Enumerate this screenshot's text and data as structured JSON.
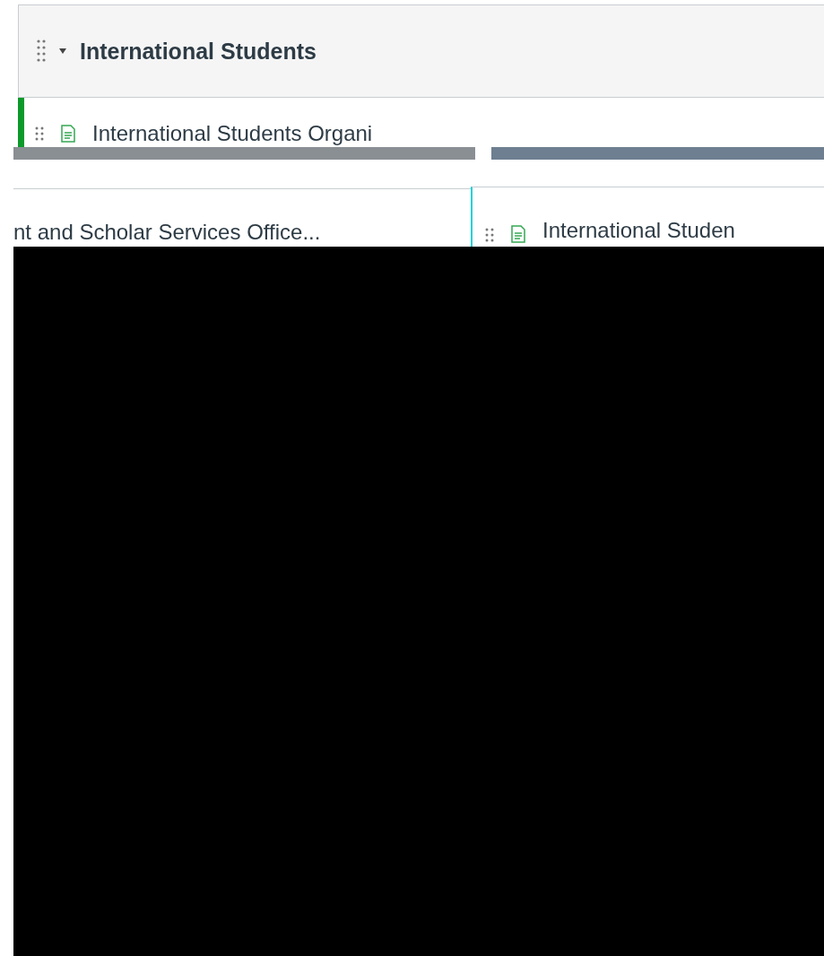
{
  "module": {
    "title": "International Students",
    "expanded": true
  },
  "item": {
    "title": "International Students Organi"
  },
  "left_panel": {
    "title": "nt and Scholar Services Office..."
  },
  "right_panel": {
    "title": "International Studen"
  }
}
